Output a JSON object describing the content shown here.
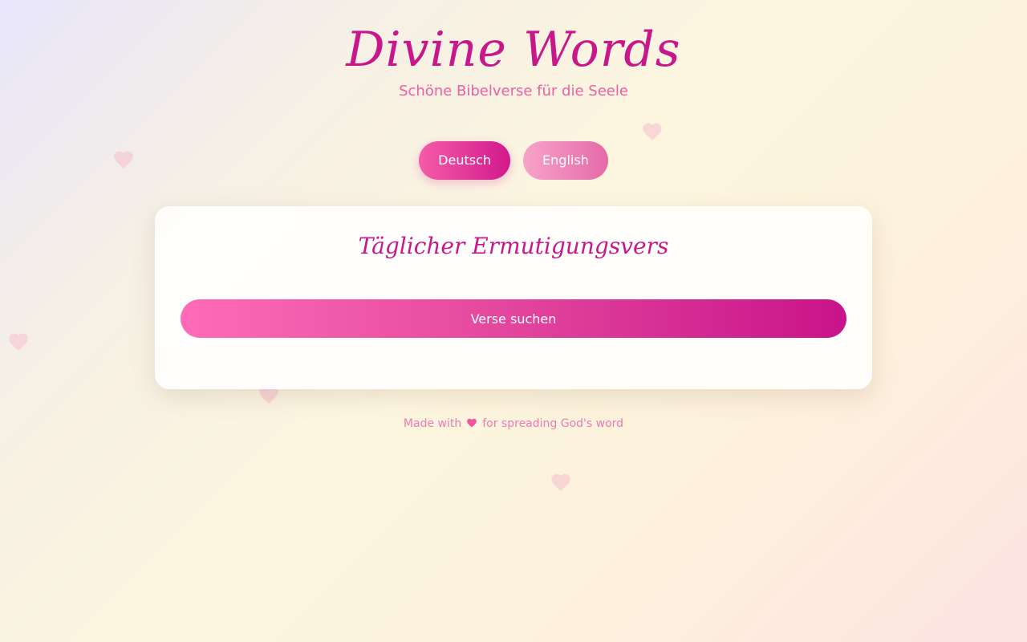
{
  "app": {
    "title": "Divine Words",
    "subtitle": "Schöne Bibelverse für die Seele"
  },
  "language_switcher": {
    "buttons": [
      {
        "label": "Deutsch",
        "active": true
      },
      {
        "label": "English",
        "active": false
      }
    ]
  },
  "card": {
    "title": "Täglicher Ermutigungsvers",
    "search_button_label": "Verse suchen"
  },
  "footer": {
    "text_before": "Made with",
    "icon": "heart-icon",
    "text_after": "for spreading God's word"
  },
  "decor": {
    "icon": "heart-icon"
  },
  "colors": {
    "brand": "#c8178a",
    "accent": "#ff6bb8",
    "decor_heart": "#f7c1d3"
  }
}
